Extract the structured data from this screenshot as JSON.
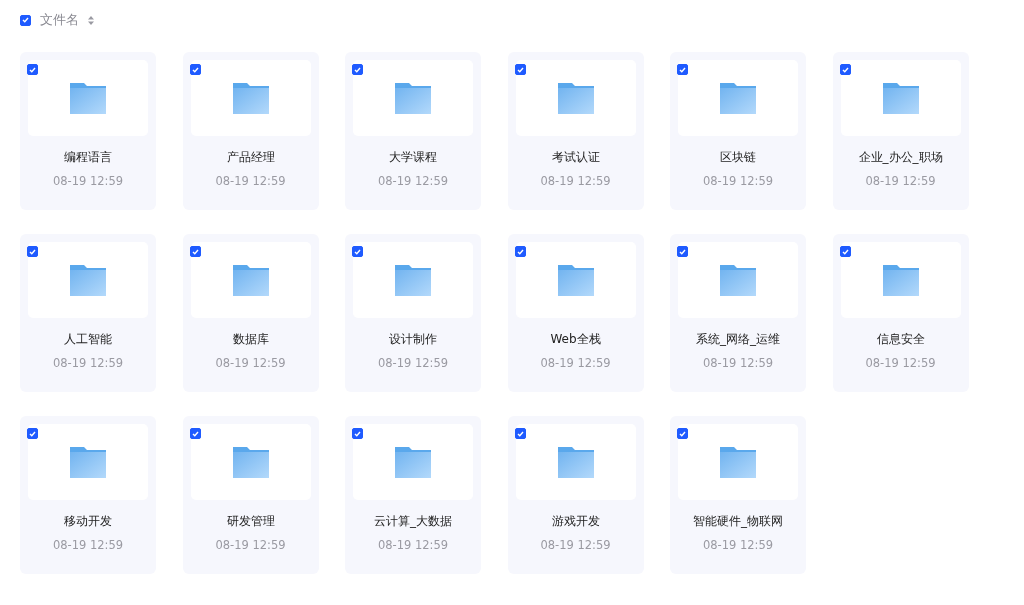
{
  "header": {
    "checked": true,
    "label": "文件名"
  },
  "files": [
    {
      "name": "编程语言",
      "date": "08-19 12:59",
      "checked": true
    },
    {
      "name": "产品经理",
      "date": "08-19 12:59",
      "checked": true
    },
    {
      "name": "大学课程",
      "date": "08-19 12:59",
      "checked": true
    },
    {
      "name": "考试认证",
      "date": "08-19 12:59",
      "checked": true
    },
    {
      "name": "区块链",
      "date": "08-19 12:59",
      "checked": true
    },
    {
      "name": "企业_办公_职场",
      "date": "08-19 12:59",
      "checked": true
    },
    {
      "name": "人工智能",
      "date": "08-19 12:59",
      "checked": true
    },
    {
      "name": "数据库",
      "date": "08-19 12:59",
      "checked": true
    },
    {
      "name": "设计制作",
      "date": "08-19 12:59",
      "checked": true
    },
    {
      "name": "Web全栈",
      "date": "08-19 12:59",
      "checked": true
    },
    {
      "name": "系统_网络_运维",
      "date": "08-19 12:59",
      "checked": true
    },
    {
      "name": "信息安全",
      "date": "08-19 12:59",
      "checked": true
    },
    {
      "name": "移动开发",
      "date": "08-19 12:59",
      "checked": true
    },
    {
      "name": "研发管理",
      "date": "08-19 12:59",
      "checked": true
    },
    {
      "name": "云计算_大数据",
      "date": "08-19 12:59",
      "checked": true
    },
    {
      "name": "游戏开发",
      "date": "08-19 12:59",
      "checked": true
    },
    {
      "name": "智能硬件_物联网",
      "date": "08-19 12:59",
      "checked": true
    }
  ]
}
